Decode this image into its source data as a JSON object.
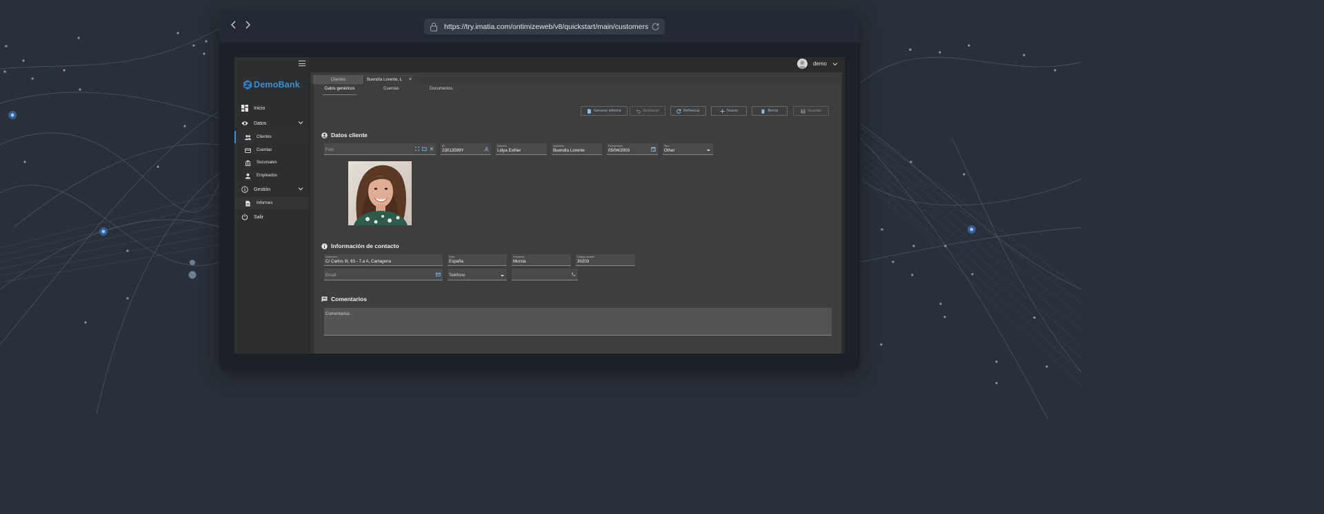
{
  "browser": {
    "url": "https://try.imatia.com/ontimizeweb/v8/quickstart/main/customers",
    "back_icon": "chevron-left-icon",
    "forward_icon": "chevron-right-icon"
  },
  "brand": {
    "name": "DemoBank",
    "color": "#3a8fd1"
  },
  "user": {
    "name": "demo"
  },
  "sidebar": {
    "items": [
      {
        "label": "Inicio",
        "icon": "dashboard-icon"
      },
      {
        "label": "Datos",
        "icon": "eye-icon"
      },
      {
        "label": "Clientes",
        "icon": "people-icon"
      },
      {
        "label": "Cuentas",
        "icon": "credit-card-icon"
      },
      {
        "label": "Sucursales",
        "icon": "bank-icon"
      },
      {
        "label": "Empleados",
        "icon": "person-icon"
      },
      {
        "label": "Gestión",
        "icon": "info-icon"
      },
      {
        "label": "Informes",
        "icon": "document-icon"
      },
      {
        "label": "Salir",
        "icon": "power-icon"
      }
    ]
  },
  "tabs": [
    {
      "label": "Clientes"
    },
    {
      "label": "Buendía Lorente, L"
    }
  ],
  "subtabs": [
    "Datos genéricos",
    "Cuentas",
    "Documentos"
  ],
  "toolbar": {
    "generar": "Generar informe",
    "deshacer": "Deshacer",
    "refrescar": "Refrescar",
    "nuevo": "Nuevo",
    "borrar": "Borrar",
    "guardar": "Guardar"
  },
  "sections": {
    "datos": "Datos cliente",
    "contacto": "Información de contacto",
    "comentarios": "Comentarios"
  },
  "customer": {
    "foto_placeholder": "Foto",
    "id_label": "ID",
    "id": "23013599Y",
    "nombre_label": "Nombre",
    "nombre": "Lidya Esther",
    "apellidos_label": "Apellidos",
    "apellidos": "Buendía Lorente",
    "fecha_label": "Fecha inicio",
    "fecha": "05/04/2003",
    "tipo_label": "Tipo",
    "tipo": "Other"
  },
  "contact": {
    "direccion_label": "Dirección",
    "direccion": "C/ Carlos III, 63 - 7.a A, Cartagena",
    "pais_label": "País",
    "pais": "España",
    "provincia_label": "Provincia",
    "provincia": "Murcia",
    "cp_label": "Código postal",
    "cp": "30203",
    "email_placeholder": "Email",
    "telefono_placeholder": "Teléfono"
  },
  "comentarios_placeholder": "Comentarios"
}
